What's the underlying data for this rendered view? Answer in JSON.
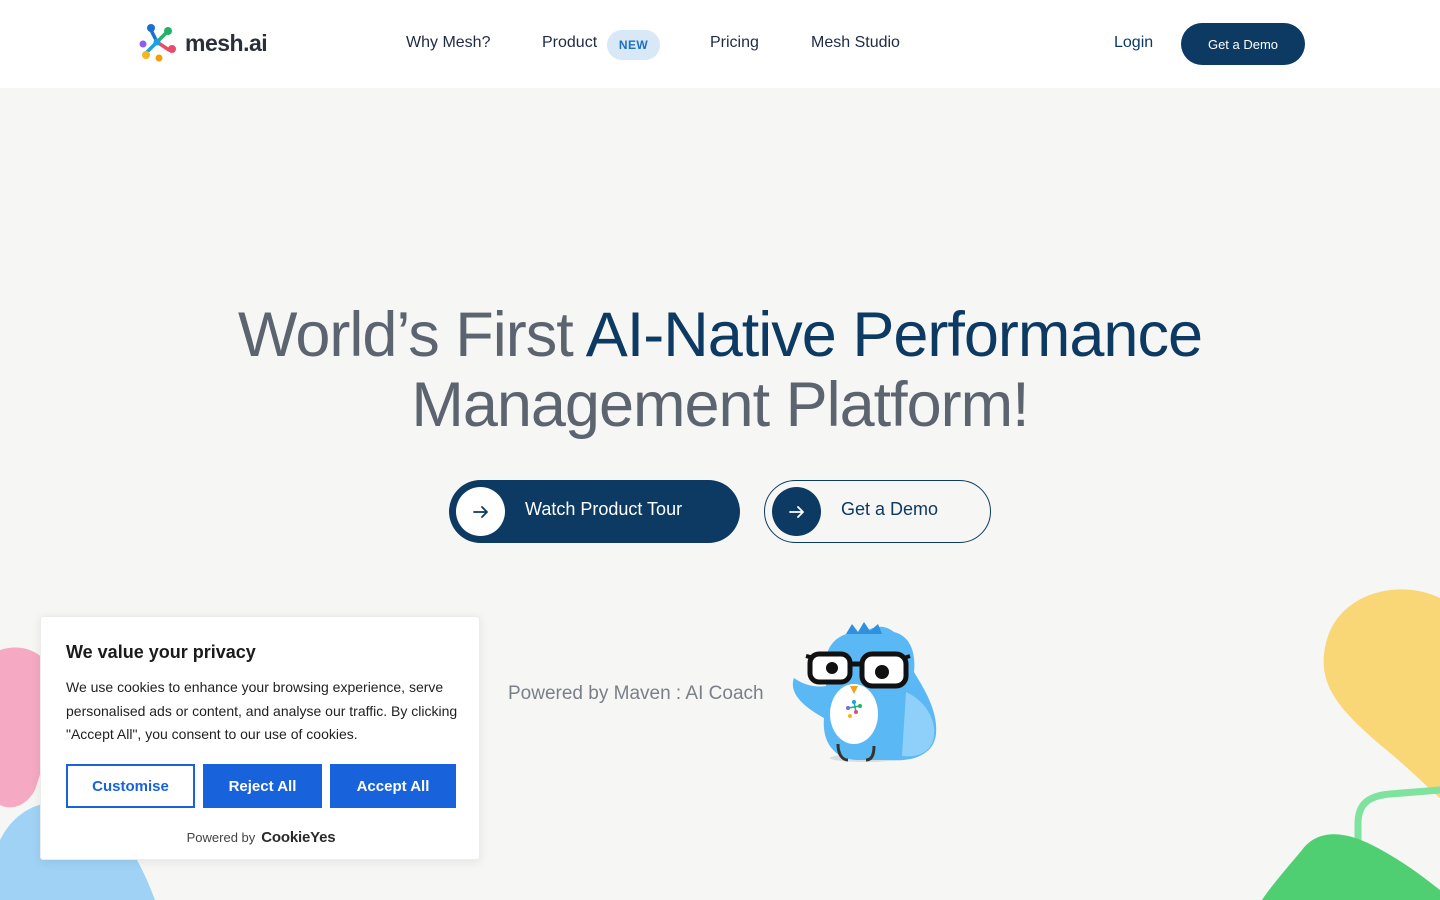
{
  "header": {
    "logo_text": "mesh.ai",
    "nav": [
      {
        "label": "Why Mesh?"
      },
      {
        "label": "Product",
        "badge": "NEW"
      },
      {
        "label": "Pricing"
      },
      {
        "label": "Mesh Studio"
      }
    ],
    "login_label": "Login",
    "demo_label": "Get a Demo"
  },
  "hero": {
    "title_part1": "World’s First ",
    "title_accent": "AI-Native Performance",
    "title_part2": "Management Platform!",
    "cta_tour_label": "Watch Product Tour",
    "cta_demo_label": "Get a Demo",
    "powered_by": "Powered by Maven : AI Coach"
  },
  "cookie_banner": {
    "title": "We value your privacy",
    "body": "We use cookies to enhance your browsing experience, serve personalised ads or content, and analyse our traffic. By clicking \"Accept All\", you consent to our use of cookies.",
    "customise_label": "Customise",
    "reject_label": "Reject All",
    "accept_label": "Accept All",
    "powered_prefix": "Powered by",
    "powered_brand": "CookieYes"
  },
  "colors": {
    "brand_navy": "#0c3a63",
    "cookie_blue": "#1863dc",
    "page_bg": "#f6f6f4"
  },
  "icons": [
    "mesh-logo-icon",
    "arrow-right-icon",
    "maven-owl-icon"
  ]
}
